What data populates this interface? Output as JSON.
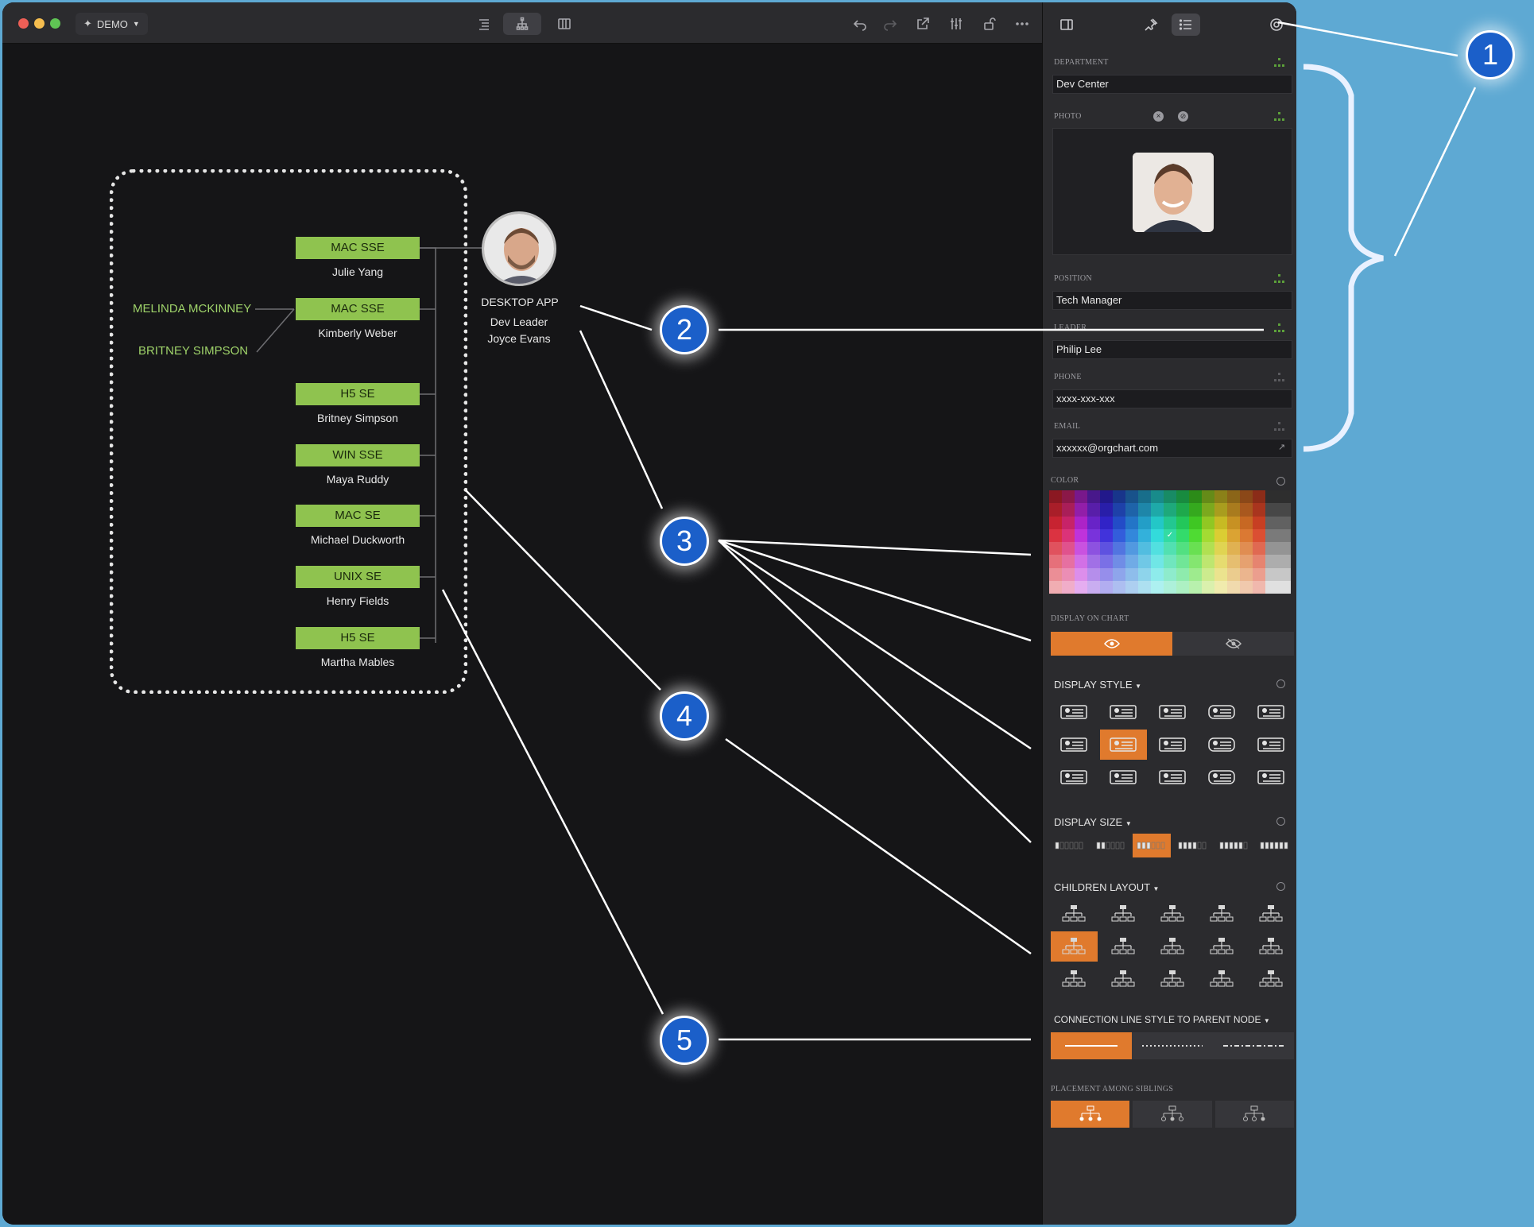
{
  "titlebar": {
    "project_label": "DEMO",
    "traffic_lights": [
      "#ed5f56",
      "#f5bd4f",
      "#5fc454"
    ],
    "icons_center": [
      "list-outline-icon",
      "org-chart-icon",
      "columns-icon"
    ],
    "icons_right": [
      "undo-icon",
      "redo-icon",
      "share-icon",
      "sliders-icon",
      "unlock-icon",
      "more-icon"
    ]
  },
  "chart": {
    "leader": {
      "department": "DESKTOP APP",
      "position": "Dev Leader",
      "name": "Joyce Evans"
    },
    "members": [
      {
        "title": "MAC SSE",
        "name": "Julie Yang"
      },
      {
        "title": "MAC SSE",
        "name": "Kimberly Weber"
      },
      {
        "title": "H5 SE",
        "name": "Britney Simpson"
      },
      {
        "title": "WIN SSE",
        "name": "Maya Ruddy"
      },
      {
        "title": "MAC SE",
        "name": "Michael Duckworth"
      },
      {
        "title": "UNIX SE",
        "name": "Henry Fields"
      },
      {
        "title": "H5 SE",
        "name": "Martha Mables"
      }
    ],
    "side_names": [
      "MELINDA MCKINNEY",
      "BRITNEY SIMPSON"
    ],
    "node_color": "#8fc34f"
  },
  "panel": {
    "tab_icons": [
      "sidebar-icon",
      "pin-icon",
      "list-icon",
      "gear-icon"
    ],
    "fields": {
      "department": {
        "label": "DEPARTMENT",
        "value": "Dev Center"
      },
      "photo": {
        "label": "PHOTO"
      },
      "position": {
        "label": "POSITION",
        "value": "Tech Manager"
      },
      "leader": {
        "label": "LEADER",
        "value": "Philip Lee"
      },
      "phone": {
        "label": "PHONE",
        "value": "xxxx-xxx-xxx"
      },
      "email": {
        "label": "EMAIL",
        "value": "xxxxxx@orgchart.com"
      }
    },
    "color": {
      "label": "COLOR",
      "selected": "#3a9a52"
    },
    "display_on_chart": {
      "label": "DISPLAY ON CHART",
      "selected": "show"
    },
    "display_style": {
      "label": "DISPLAY STYLE",
      "selected_index": 6
    },
    "display_size": {
      "label": "DISPLAY SIZE",
      "selected_index": 2
    },
    "children_layout": {
      "label": "CHILDREN LAYOUT",
      "selected_index": 5
    },
    "connection_line": {
      "label": "CONNECTION LINE STYLE TO PARENT NODE",
      "options": [
        "solid",
        "dotted",
        "dash-dot"
      ],
      "selected_index": 0
    },
    "placement": {
      "label": "PLACEMENT AMONG SIBLINGS",
      "selected_index": 0
    },
    "accent": "#e07a2d"
  },
  "annotations": {
    "badges": [
      "1",
      "2",
      "3",
      "4",
      "5"
    ],
    "color": "#1b5fc9"
  }
}
